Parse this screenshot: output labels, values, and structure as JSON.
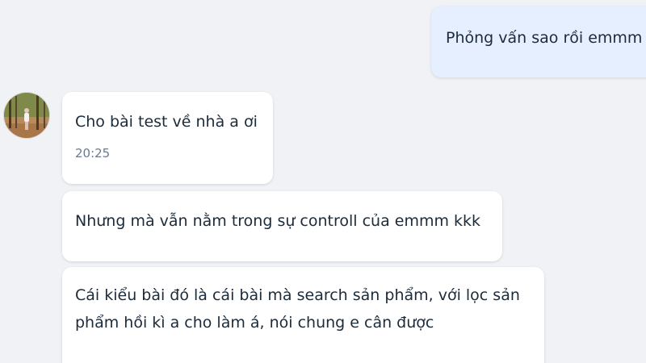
{
  "conversation": {
    "outgoing": [
      {
        "text": "Phỏng vấn sao rồi emmm"
      }
    ],
    "incoming": [
      {
        "text": "Cho bài test về nhà a ơi",
        "time": "20:25"
      },
      {
        "text": "Nhưng mà vẫn nằm trong sự controll của emmm kkk"
      },
      {
        "text": "Cái kiểu bài đó là cái bài mà search sản phẩm, với lọc sản phẩm hồi kì a cho làm á, nói chung e cân được"
      }
    ]
  },
  "colors": {
    "background": "#f0f2f5",
    "incoming_bubble": "#ffffff",
    "outgoing_bubble": "#e5efff",
    "text": "#1c2b3a",
    "timestamp": "#6b7a8c"
  }
}
